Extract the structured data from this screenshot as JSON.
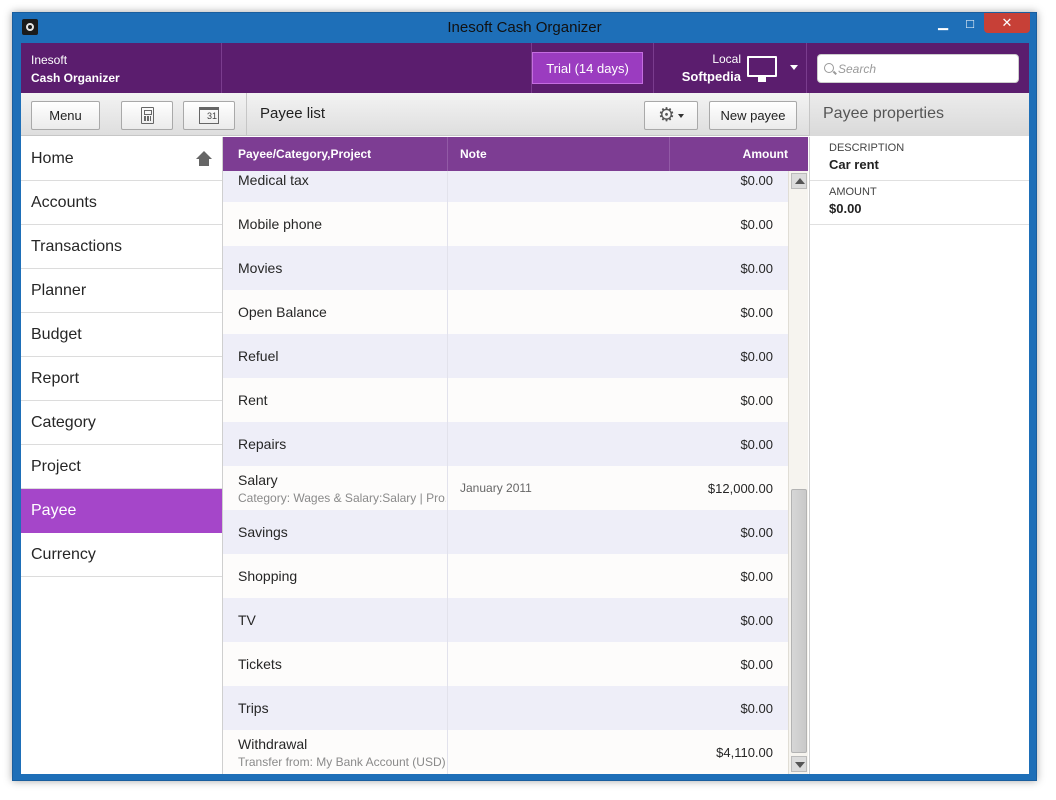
{
  "window": {
    "title": "Inesoft Cash Organizer",
    "minimize": "▁",
    "maximize": "□",
    "close": "✕"
  },
  "header": {
    "brand_line1": "Inesoft",
    "brand_line2": "Cash Organizer",
    "trial_label": "Trial (14 days)",
    "location_line1": "Local",
    "location_line2": "Softpedia",
    "search_placeholder": "Search"
  },
  "toolbar": {
    "menu_label": "Menu",
    "calendar_day": "31",
    "list_title": "Payee list",
    "new_payee_label": "New payee",
    "properties_title": "Payee properties"
  },
  "sidebar": {
    "items": [
      {
        "label": "Home"
      },
      {
        "label": "Accounts"
      },
      {
        "label": "Transactions"
      },
      {
        "label": "Planner"
      },
      {
        "label": "Budget"
      },
      {
        "label": "Report"
      },
      {
        "label": "Category"
      },
      {
        "label": "Project"
      },
      {
        "label": "Payee"
      },
      {
        "label": "Currency"
      }
    ],
    "active": "Payee"
  },
  "table": {
    "columns": [
      "Payee/Category,Project",
      "Note",
      "Amount"
    ],
    "rows": [
      {
        "payee": "Medical tax",
        "sub": "",
        "note": "",
        "amount": "$0.00"
      },
      {
        "payee": "Mobile phone",
        "sub": "",
        "note": "",
        "amount": "$0.00"
      },
      {
        "payee": "Movies",
        "sub": "",
        "note": "",
        "amount": "$0.00"
      },
      {
        "payee": "Open Balance",
        "sub": "",
        "note": "",
        "amount": "$0.00"
      },
      {
        "payee": "Refuel",
        "sub": "",
        "note": "",
        "amount": "$0.00"
      },
      {
        "payee": "Rent",
        "sub": "",
        "note": "",
        "amount": "$0.00"
      },
      {
        "payee": "Repairs",
        "sub": "",
        "note": "",
        "amount": "$0.00"
      },
      {
        "payee": "Salary",
        "sub": "Category: Wages & Salary:Salary | Pro...",
        "note": "January 2011",
        "amount": "$12,000.00"
      },
      {
        "payee": "Savings",
        "sub": "",
        "note": "",
        "amount": "$0.00"
      },
      {
        "payee": "Shopping",
        "sub": "",
        "note": "",
        "amount": "$0.00"
      },
      {
        "payee": "TV",
        "sub": "",
        "note": "",
        "amount": "$0.00"
      },
      {
        "payee": "Tickets",
        "sub": "",
        "note": "",
        "amount": "$0.00"
      },
      {
        "payee": "Trips",
        "sub": "",
        "note": "",
        "amount": "$0.00"
      },
      {
        "payee": "Withdrawal",
        "sub": "Transfer from: My Bank Account (USD)",
        "note": "",
        "amount": "$4,110.00"
      }
    ]
  },
  "properties": {
    "description_label": "DESCRIPTION",
    "description_value": "Car rent",
    "amount_label": "AMOUNT",
    "amount_value": "$0.00"
  },
  "colors": {
    "accent": "#a546c9",
    "header": "#5b1d6e",
    "table_header": "#7d3d93",
    "window_frame": "#1e6fb8"
  }
}
